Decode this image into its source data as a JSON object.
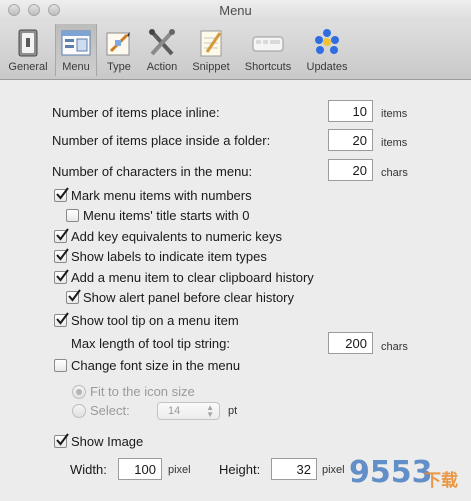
{
  "window": {
    "title": "Menu"
  },
  "toolbar": {
    "items": [
      {
        "label": "General",
        "icon": "switch-icon"
      },
      {
        "label": "Menu",
        "icon": "menu-icon"
      },
      {
        "label": "Type",
        "icon": "type-icon"
      },
      {
        "label": "Action",
        "icon": "tools-icon"
      },
      {
        "label": "Snippet",
        "icon": "notepad-icon"
      },
      {
        "label": "Shortcuts",
        "icon": "keyboard-icon"
      },
      {
        "label": "Updates",
        "icon": "updates-icon"
      }
    ],
    "selected": "Menu"
  },
  "settings": {
    "items_inline": {
      "label": "Number of items place inline:",
      "value": "10",
      "unit": "items"
    },
    "items_folder": {
      "label": "Number of items place inside a folder:",
      "value": "20",
      "unit": "items"
    },
    "chars_menu": {
      "label": "Number of characters in the menu:",
      "value": "20",
      "unit": "chars"
    },
    "mark_numbers": {
      "label": "Mark menu items with numbers",
      "checked": true
    },
    "title_zero": {
      "label": "Menu items' title starts with 0",
      "checked": false
    },
    "key_equivalents": {
      "label": "Add key equivalents to numeric keys",
      "checked": true
    },
    "show_labels": {
      "label": "Show labels to indicate item types",
      "checked": true
    },
    "clear_history": {
      "label": "Add a menu item to clear clipboard history",
      "checked": true
    },
    "alert_panel": {
      "label": "Show alert panel before clear history",
      "checked": true
    },
    "tool_tip": {
      "label": "Show tool tip on a menu item",
      "checked": true
    },
    "tooltip_length": {
      "label": "Max length of tool tip string:",
      "value": "200",
      "unit": "chars"
    },
    "change_font": {
      "label": "Change font size in the menu",
      "checked": false
    },
    "fit_icon": {
      "label": "Fit to the icon size",
      "selected": true
    },
    "select_size": {
      "label": "Select:",
      "value": "14",
      "unit": "pt"
    },
    "show_image": {
      "label": "Show Image",
      "checked": true
    },
    "width": {
      "label": "Width:",
      "value": "100",
      "unit": "pixel"
    },
    "height": {
      "label": "Height:",
      "value": "32",
      "unit": "pixel"
    }
  },
  "watermark": {
    "site": "9553",
    "suffix": "下载"
  },
  "colors": {
    "checkmark": "#1a1a1a",
    "watermark_blue": "#4a7fc1",
    "watermark_orange": "#e8892b"
  }
}
